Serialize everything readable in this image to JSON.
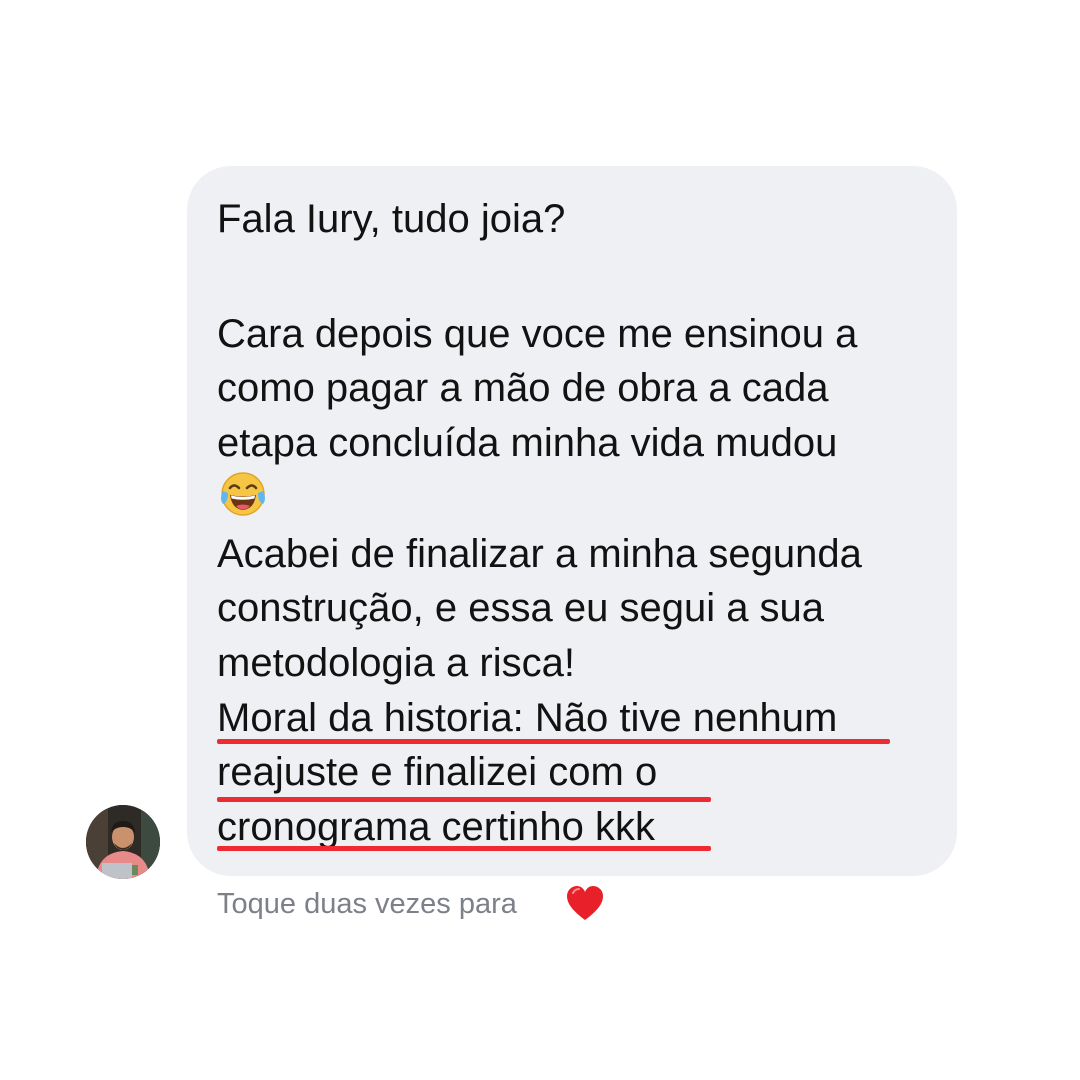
{
  "message": {
    "lines": [
      "Fala Iury, tudo joia?",
      "Cara depois que voce me ensinou a",
      "como pagar a mão de obra a cada",
      "etapa concluída minha vida mudou",
      "Acabei de finalizar a minha segunda",
      "construção, e essa eu segui a sua",
      "metodologia a risca!",
      "Moral da historia: Não tive nenhum",
      "reajuste e finalizei com o",
      "cronograma certinho kkk"
    ],
    "emoji": "face-with-tears-of-joy",
    "highlight_color": "#ee2b33",
    "bubble_color": "#eff0f3"
  },
  "footer": {
    "hint": "Toque duas vezes para",
    "reaction_icon": "heart-icon"
  },
  "sender": {
    "avatar_icon": "avatar-photo"
  }
}
